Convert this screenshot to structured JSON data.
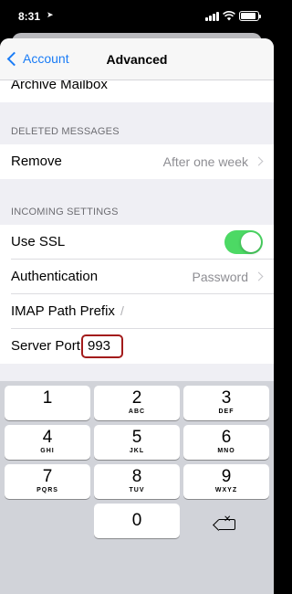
{
  "status_bar": {
    "time": "8:31",
    "location_icon": "location-arrow-icon",
    "signal_icon": "cellular-signal-icon",
    "wifi_icon": "wifi-icon",
    "battery_icon": "battery-icon",
    "battery_level": 0.9
  },
  "nav": {
    "back_label": "Account",
    "title": "Advanced"
  },
  "archive_row": {
    "label": "Archive Mailbox"
  },
  "deleted_section": {
    "header": "DELETED MESSAGES",
    "remove": {
      "label": "Remove",
      "value": "After one week"
    }
  },
  "incoming_section": {
    "header": "INCOMING SETTINGS",
    "use_ssl": {
      "label": "Use SSL",
      "enabled": true
    },
    "authentication": {
      "label": "Authentication",
      "value": "Password"
    },
    "imap_path_prefix": {
      "label": "IMAP Path Prefix",
      "value": "/"
    },
    "server_port": {
      "label": "Server Port",
      "value": "993"
    }
  },
  "colors": {
    "accent": "#1a7cf6",
    "toggle_on": "#4cd964",
    "highlight": "#a31b1b"
  },
  "keypad": {
    "keys": [
      {
        "num": "1",
        "letters": ""
      },
      {
        "num": "2",
        "letters": "ABC"
      },
      {
        "num": "3",
        "letters": "DEF"
      },
      {
        "num": "4",
        "letters": "GHI"
      },
      {
        "num": "5",
        "letters": "JKL"
      },
      {
        "num": "6",
        "letters": "MNO"
      },
      {
        "num": "7",
        "letters": "PQRS"
      },
      {
        "num": "8",
        "letters": "TUV"
      },
      {
        "num": "9",
        "letters": "WXYZ"
      },
      {
        "num": "0",
        "letters": ""
      }
    ],
    "delete_icon": "delete-backspace-icon"
  }
}
